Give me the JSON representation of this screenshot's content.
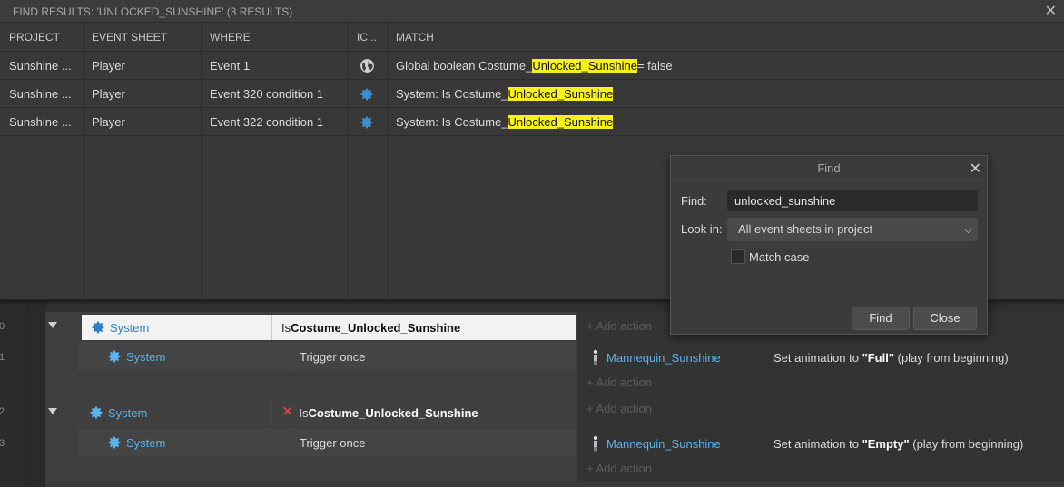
{
  "results_panel": {
    "title": "FIND RESULTS: 'UNLOCKED_SUNSHINE' (3 RESULTS)",
    "columns": [
      "PROJECT",
      "EVENT SHEET",
      "WHERE",
      "IC...",
      "MATCH"
    ],
    "rows": [
      {
        "project": "Sunshine ...",
        "sheet": "Player",
        "where": "Event 1",
        "icon": "globe-icon",
        "match_pre": "Global boolean Costume_",
        "match_hl": "Unlocked_Sunshine",
        "match_post": " = false"
      },
      {
        "project": "Sunshine ...",
        "sheet": "Player",
        "where": "Event 320 condition 1",
        "icon": "gear-icon",
        "match_pre": "System: Is Costume_",
        "match_hl": "Unlocked_Sunshine",
        "match_post": ""
      },
      {
        "project": "Sunshine ...",
        "sheet": "Player",
        "where": "Event 322 condition 1",
        "icon": "gear-icon",
        "match_pre": "System: Is Costume_",
        "match_hl": "Unlocked_Sunshine",
        "match_post": ""
      }
    ]
  },
  "find_dialog": {
    "title": "Find",
    "find_label": "Find:",
    "find_value": "unlocked_sunshine",
    "lookin_label": "Look in:",
    "lookin_value": "All event sheets in project",
    "match_case_label": "Match case",
    "match_case_checked": false,
    "find_button": "Find",
    "close_button": "Close"
  },
  "event_sheet": {
    "line_numbers": [
      "0",
      "1",
      "2",
      "3"
    ],
    "add_action": "+ Add action",
    "events": [
      {
        "cond_object": "System",
        "cond_prefix": "Is ",
        "cond_bold": "Costume_Unlocked_Sunshine",
        "inverted": false,
        "sub_object": "System",
        "sub_text": "Trigger once",
        "action_object": "Mannequin_Sunshine",
        "action_pre": "Set animation to ",
        "action_bold": "\"Full\"",
        "action_post": " (play from beginning)"
      },
      {
        "cond_object": "System",
        "cond_prefix": "Is ",
        "cond_bold": "Costume_Unlocked_Sunshine",
        "inverted": true,
        "sub_object": "System",
        "sub_text": "Trigger once",
        "action_object": "Mannequin_Sunshine",
        "action_pre": "Set animation to ",
        "action_bold": "\"Empty\"",
        "action_post": " (play from beginning)"
      }
    ]
  },
  "colors": {
    "highlight": "#f7f21a",
    "object_link": "#5ab3ec",
    "invert_x": "#e04848"
  }
}
